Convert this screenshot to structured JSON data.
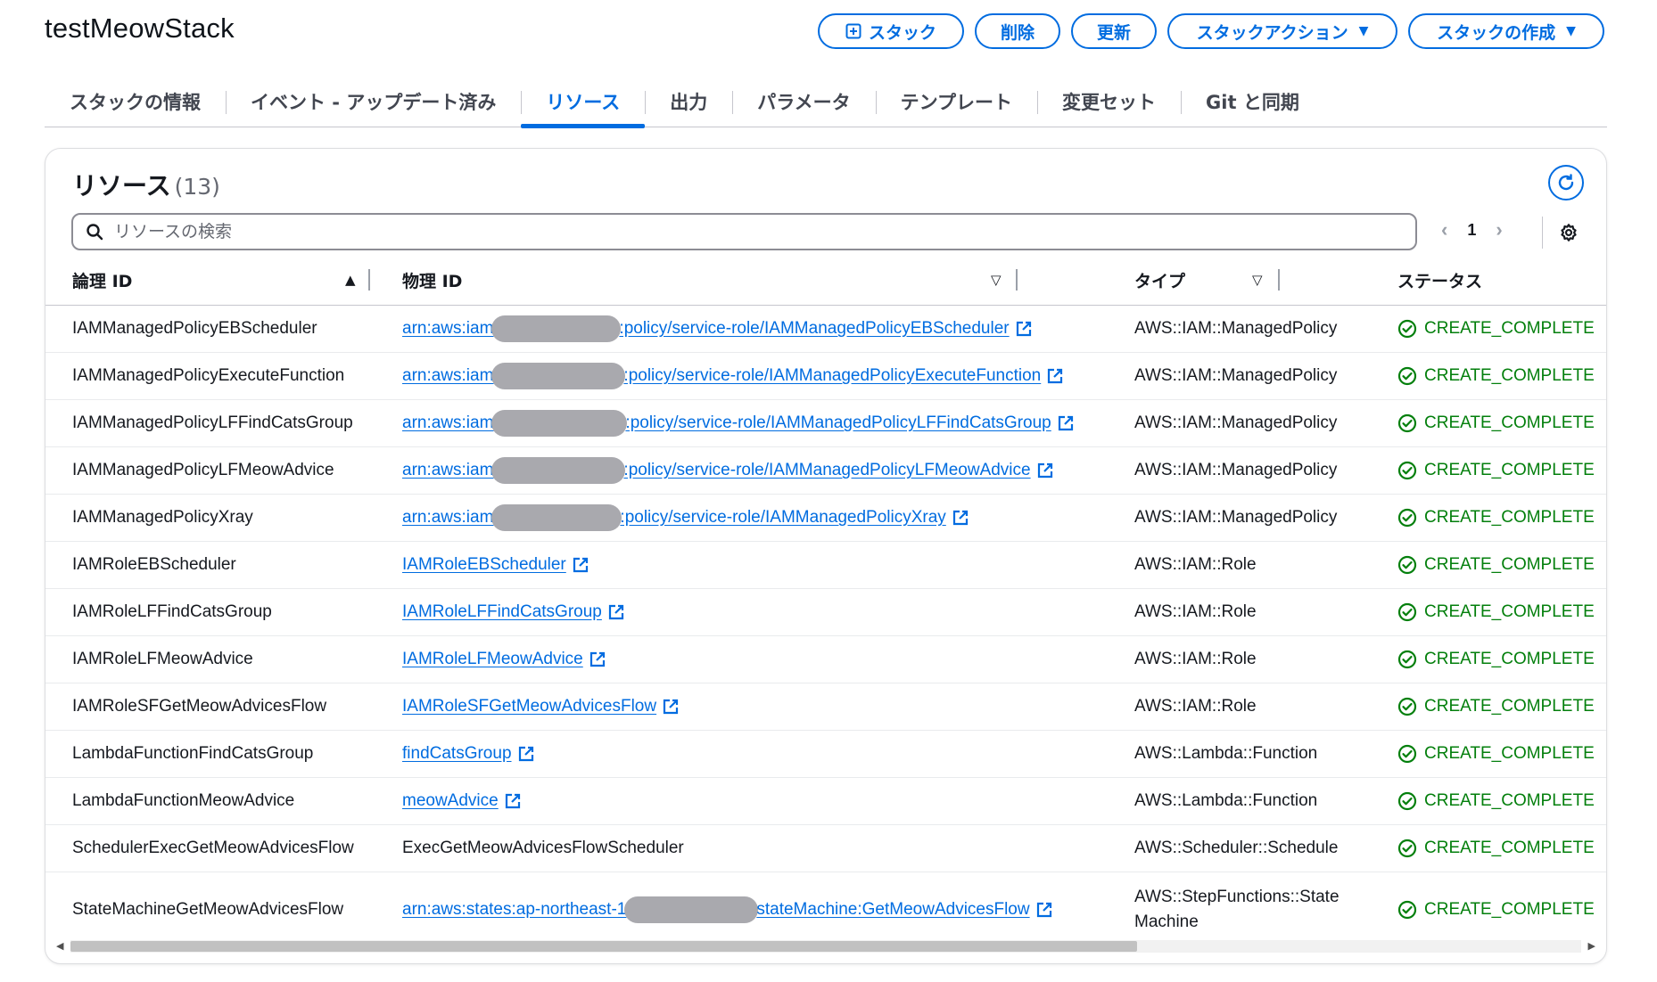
{
  "stack": {
    "title": "testMeowStack"
  },
  "actions": [
    {
      "id": "stack",
      "label": "スタック",
      "icon": "plus-square-icon"
    },
    {
      "id": "delete",
      "label": "削除"
    },
    {
      "id": "update",
      "label": "更新"
    },
    {
      "id": "stack-actions",
      "label": "スタックアクション",
      "caret": "▼"
    },
    {
      "id": "create-stack",
      "label": "スタックの作成",
      "caret": "▼"
    }
  ],
  "tabs": [
    {
      "label": "スタックの情報",
      "active": false
    },
    {
      "label": "イベント - アップデート済み",
      "active": false
    },
    {
      "label": "リソース",
      "active": true
    },
    {
      "label": "出力",
      "active": false
    },
    {
      "label": "パラメータ",
      "active": false
    },
    {
      "label": "テンプレート",
      "active": false
    },
    {
      "label": "変更セット",
      "active": false
    },
    {
      "label": "Git と同期",
      "active": false
    }
  ],
  "resources": {
    "title": "リソース",
    "count": "(13)",
    "search_placeholder": "リソースの検索",
    "page": "1",
    "columns": {
      "logical_id": "論理 ID",
      "physical_id": "物理 ID",
      "type": "タイプ",
      "status": "ステータス"
    },
    "rows": [
      {
        "logical": "IAMManagedPolicyEBScheduler",
        "phys_pre": "arn:aws:iam",
        "redacted": true,
        "phys_post": ":policy/service-role/IAMManagedPolicyEBScheduler",
        "link": true,
        "type": "AWS::IAM::ManagedPolicy",
        "status": "CREATE_COMPLETE"
      },
      {
        "logical": "IAMManagedPolicyExecuteFunction",
        "phys_pre": "arn:aws:iam",
        "redacted": true,
        "phys_post": ":policy/service-role/IAMManagedPolicyExecuteFunction",
        "link": true,
        "type": "AWS::IAM::ManagedPolicy",
        "status": "CREATE_COMPLETE"
      },
      {
        "logical": "IAMManagedPolicyLFFindCatsGroup",
        "phys_pre": "arn:aws:iam",
        "redacted": true,
        "phys_post": ":policy/service-role/IAMManagedPolicyLFFindCatsGroup",
        "link": true,
        "type": "AWS::IAM::ManagedPolicy",
        "status": "CREATE_COMPLETE"
      },
      {
        "logical": "IAMManagedPolicyLFMeowAdvice",
        "phys_pre": "arn:aws:iam",
        "redacted": true,
        "phys_post": ":policy/service-role/IAMManagedPolicyLFMeowAdvice",
        "link": true,
        "type": "AWS::IAM::ManagedPolicy",
        "status": "CREATE_COMPLETE"
      },
      {
        "logical": "IAMManagedPolicyXray",
        "phys_pre": "arn:aws:iam",
        "redacted": true,
        "phys_post": ":policy/service-role/IAMManagedPolicyXray",
        "link": true,
        "type": "AWS::IAM::ManagedPolicy",
        "status": "CREATE_COMPLETE"
      },
      {
        "logical": "IAMRoleEBScheduler",
        "phys_pre": "IAMRoleEBScheduler",
        "redacted": false,
        "phys_post": "",
        "link": true,
        "type": "AWS::IAM::Role",
        "status": "CREATE_COMPLETE"
      },
      {
        "logical": "IAMRoleLFFindCatsGroup",
        "phys_pre": "IAMRoleLFFindCatsGroup",
        "redacted": false,
        "phys_post": "",
        "link": true,
        "type": "AWS::IAM::Role",
        "status": "CREATE_COMPLETE"
      },
      {
        "logical": "IAMRoleLFMeowAdvice",
        "phys_pre": "IAMRoleLFMeowAdvice",
        "redacted": false,
        "phys_post": "",
        "link": true,
        "type": "AWS::IAM::Role",
        "status": "CREATE_COMPLETE"
      },
      {
        "logical": "IAMRoleSFGetMeowAdvicesFlow",
        "phys_pre": "IAMRoleSFGetMeowAdvicesFlow",
        "redacted": false,
        "phys_post": "",
        "link": true,
        "type": "AWS::IAM::Role",
        "status": "CREATE_COMPLETE"
      },
      {
        "logical": "LambdaFunctionFindCatsGroup",
        "phys_pre": "findCatsGroup",
        "redacted": false,
        "phys_post": "",
        "link": true,
        "type": "AWS::Lambda::Function",
        "status": "CREATE_COMPLETE"
      },
      {
        "logical": "LambdaFunctionMeowAdvice",
        "phys_pre": "meowAdvice",
        "redacted": false,
        "phys_post": "",
        "link": true,
        "type": "AWS::Lambda::Function",
        "status": "CREATE_COMPLETE"
      },
      {
        "logical": "SchedulerExecGetMeowAdvicesFlow",
        "phys_pre": "ExecGetMeowAdvicesFlowScheduler",
        "redacted": false,
        "phys_post": "",
        "link": false,
        "type": "AWS::Scheduler::Schedule",
        "status": "CREATE_COMPLETE"
      },
      {
        "logical": "StateMachineGetMeowAdvicesFlow",
        "phys_pre": "arn:aws:states:ap-northeast-1",
        "redacted": true,
        "phys_post": "stateMachine:GetMeowAdvicesFlow",
        "link": true,
        "type": "AWS::StepFunctions::State Machine",
        "type_lines": [
          "AWS::StepFunctions::State",
          "Machine"
        ],
        "status": "CREATE_COMPLETE"
      }
    ]
  },
  "colors": {
    "accent": "#006ce0",
    "success": "#037f0c",
    "redaction": "#a9a9ae"
  }
}
